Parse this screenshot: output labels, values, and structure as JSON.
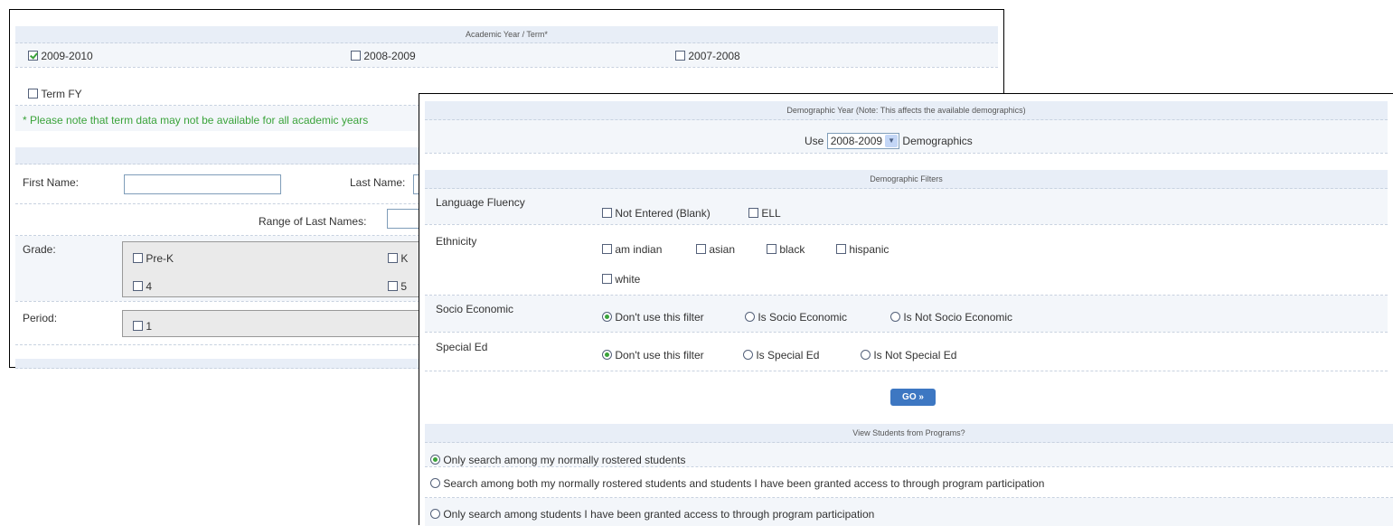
{
  "back_panel": {
    "academic_header": "Academic Year / Term*",
    "years": [
      {
        "label": "2009-2010",
        "checked": true
      },
      {
        "label": "2008-2009",
        "checked": false
      },
      {
        "label": "2007-2008",
        "checked": false
      }
    ],
    "term": {
      "label": "Term FY",
      "checked": false
    },
    "note": "* Please note that term data may not be available for all academic years",
    "first_name_label": "First Name:",
    "first_name_value": "",
    "last_name_label": "Last Name:",
    "range_label": "Range of Last Names:",
    "grade_label": "Grade:",
    "grades": [
      "Pre-K",
      "K",
      "4",
      "5"
    ],
    "period_label": "Period:",
    "periods": [
      "1"
    ]
  },
  "front_panel": {
    "demo_year_header": "Demographic Year (Note: This affects the available demographics)",
    "use_label": "Use",
    "demo_year_selected": "2008-2009",
    "demographics_label": "Demographics",
    "filters_header": "Demographic Filters",
    "language": {
      "label": "Language Fluency",
      "options": [
        "Not Entered (Blank)",
        "ELL"
      ]
    },
    "ethnicity": {
      "label": "Ethnicity",
      "options": [
        "am indian",
        "asian",
        "black",
        "hispanic",
        "white"
      ]
    },
    "socio": {
      "label": "Socio Economic",
      "options": [
        "Don't use this filter",
        "Is Socio Economic",
        "Is Not Socio Economic"
      ],
      "selected": 0
    },
    "special_ed": {
      "label": "Special Ed",
      "options": [
        "Don't use this filter",
        "Is Special Ed",
        "Is Not Special Ed"
      ],
      "selected": 0
    },
    "go_label": "GO",
    "go_icon": "double-chevron-right-icon",
    "programs_header": "View Students from Programs?",
    "programs_options": [
      "Only search among my normally rostered students",
      "Search among both my normally rostered students and students I have been granted access to through program participation",
      "Only search among students I have been granted access to through program participation"
    ],
    "programs_selected": 0
  }
}
